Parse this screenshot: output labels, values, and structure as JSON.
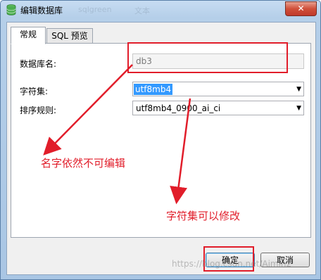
{
  "window": {
    "title": "编辑数据库",
    "title_ghost_texts": [
      "sqlgreen",
      "文本"
    ],
    "close_symbol": "✕"
  },
  "tabs": [
    {
      "label": "常规",
      "active": true
    },
    {
      "label": "SQL 预览",
      "active": false
    }
  ],
  "form": {
    "db_name_label": "数据库名:",
    "db_name_value": "db3",
    "charset_label": "字符集:",
    "charset_value": "utf8mb4",
    "collation_label": "排序规则:",
    "collation_value": "utf8mb4_0900_ai_ci"
  },
  "buttons": {
    "ok": "确定",
    "cancel": "取消"
  },
  "annotations": {
    "name_note": "名字依然不可编辑",
    "charset_note": "字符集可以修改"
  },
  "watermark": "https://blog.csdn.net/Aimin2",
  "colors": {
    "annotation_red": "#e11d2a",
    "selection_blue": "#3399ff",
    "title_bar": "#b5cfe9"
  },
  "icons": {
    "title_icon": "database-icon",
    "dropdown_icon": "chevron-down-icon"
  }
}
